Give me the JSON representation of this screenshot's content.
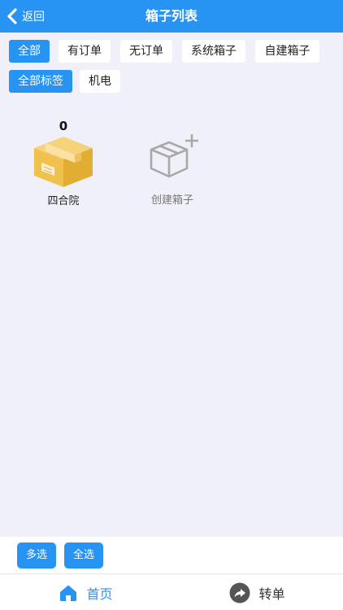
{
  "header": {
    "back_label": "返回",
    "title": "箱子列表"
  },
  "filters": {
    "order_tabs": [
      {
        "label": "全部",
        "active": true
      },
      {
        "label": "有订单",
        "active": false
      },
      {
        "label": "无订单",
        "active": false
      },
      {
        "label": "系统箱子",
        "active": false
      },
      {
        "label": "自建箱子",
        "active": false
      }
    ],
    "tag_tabs": [
      {
        "label": "全部标签",
        "active": true
      },
      {
        "label": "机电",
        "active": false
      }
    ]
  },
  "boxes": [
    {
      "count": "0",
      "name": "四合院",
      "icon": "cardboard-box-icon"
    }
  ],
  "create_box": {
    "label": "创建箱子",
    "icon": "box-plus-icon"
  },
  "actions": {
    "multi_select": "多选",
    "select_all": "全选"
  },
  "tabbar": {
    "home": "首页",
    "transfer": "转单"
  },
  "colors": {
    "primary": "#2794f4",
    "background": "#f0f0fb",
    "box_yellow": "#f0c24d"
  }
}
